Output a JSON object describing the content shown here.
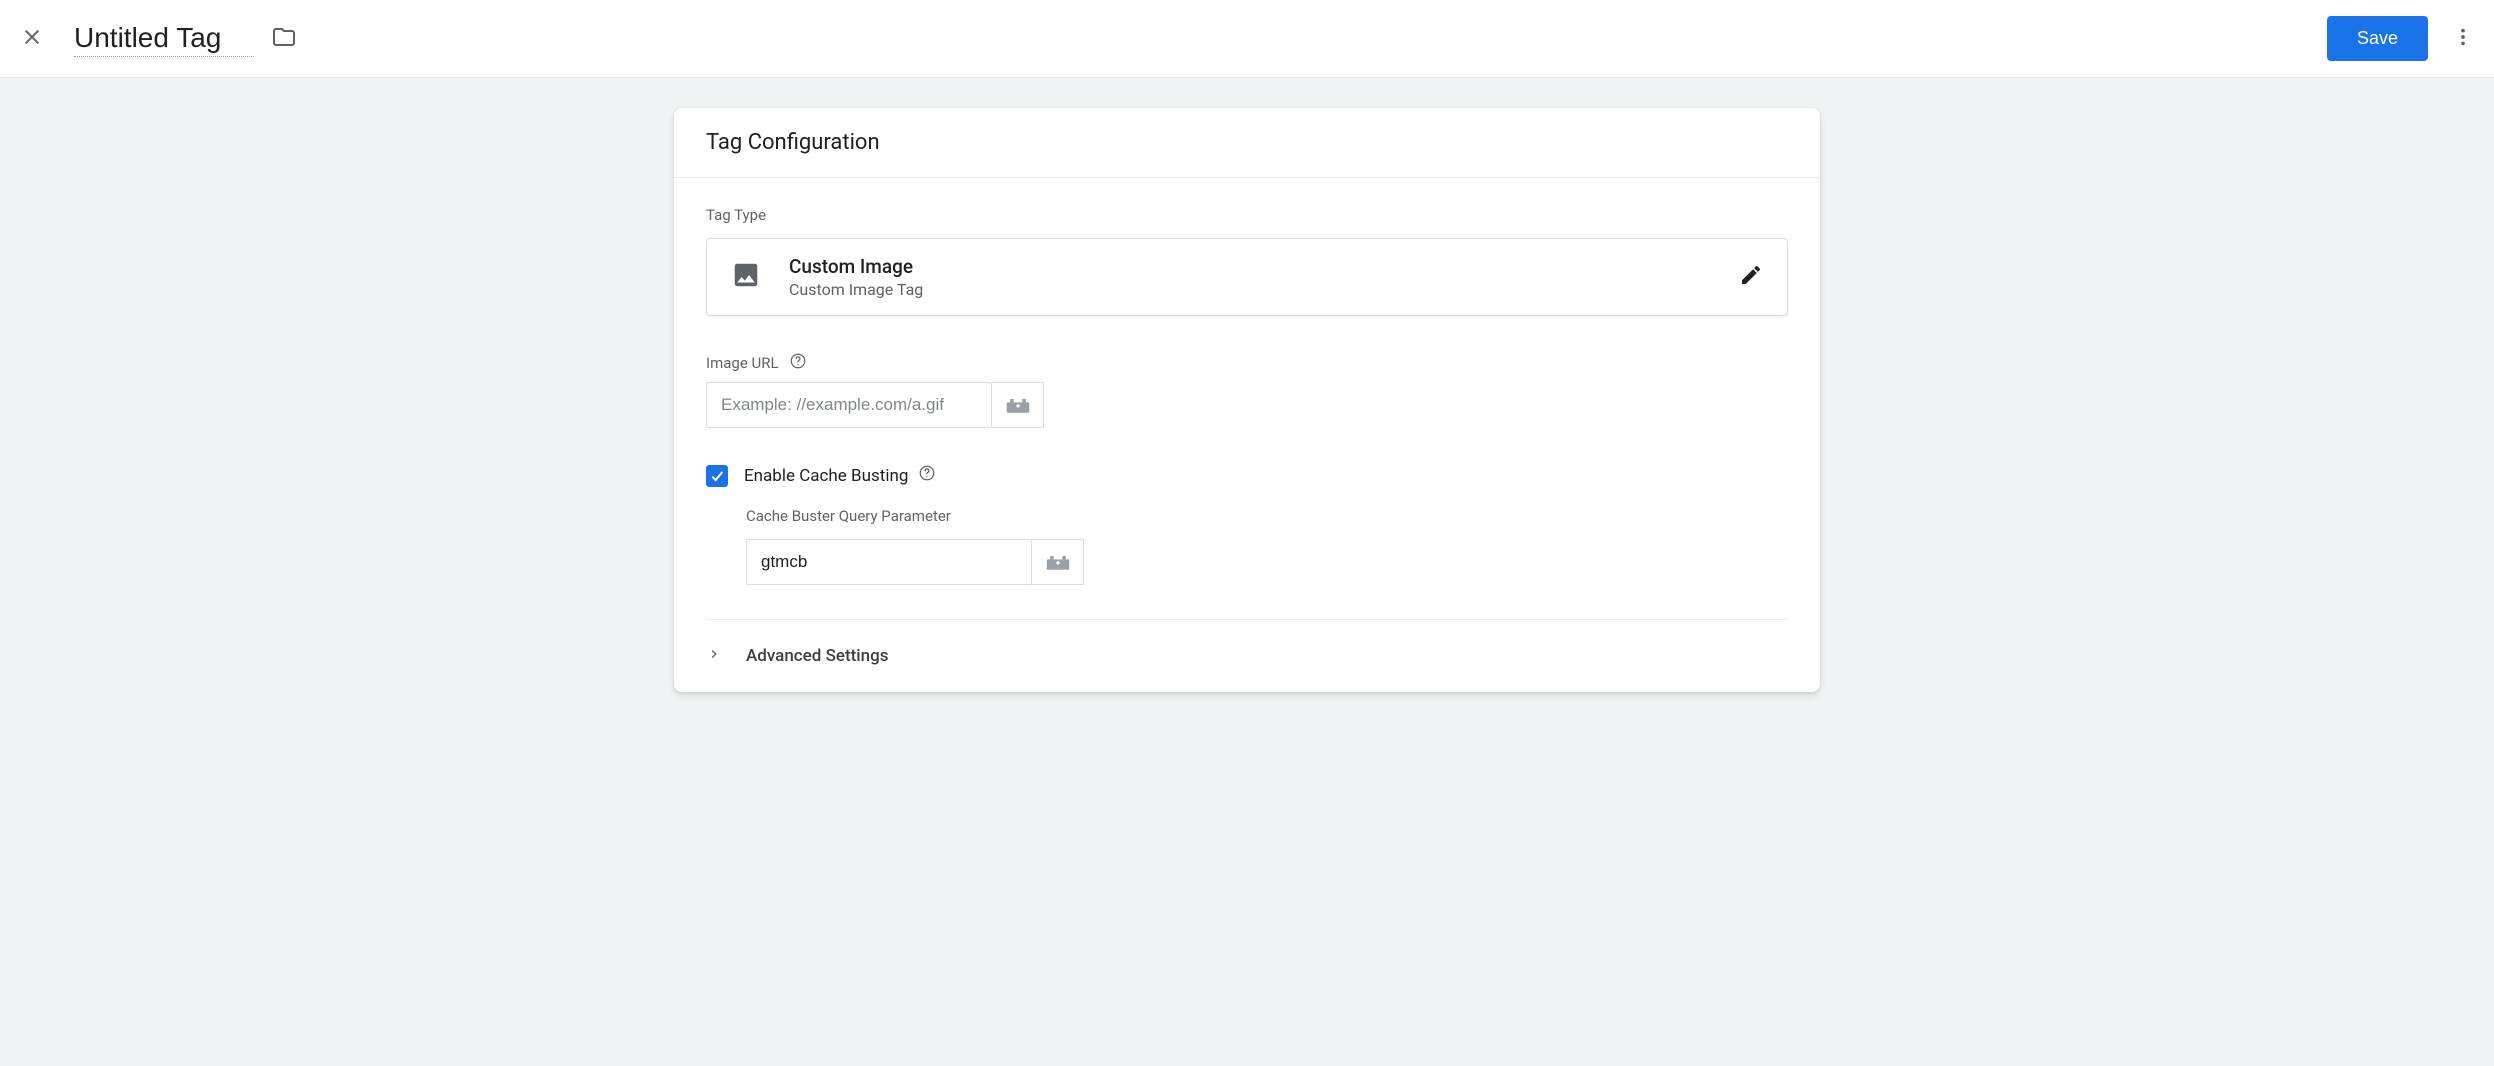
{
  "header": {
    "title": "Untitled Tag",
    "save_label": "Save"
  },
  "card": {
    "title": "Tag Configuration",
    "tag_type_label": "Tag Type",
    "tag_type": {
      "name": "Custom Image",
      "sub": "Custom Image Tag"
    },
    "image_url": {
      "label": "Image URL",
      "placeholder": "Example: //example.com/a.gif",
      "value": ""
    },
    "cache_busting": {
      "label": "Enable Cache Busting",
      "checked": true,
      "param_label": "Cache Buster Query Parameter",
      "param_value": "gtmcb"
    },
    "advanced_label": "Advanced Settings"
  }
}
